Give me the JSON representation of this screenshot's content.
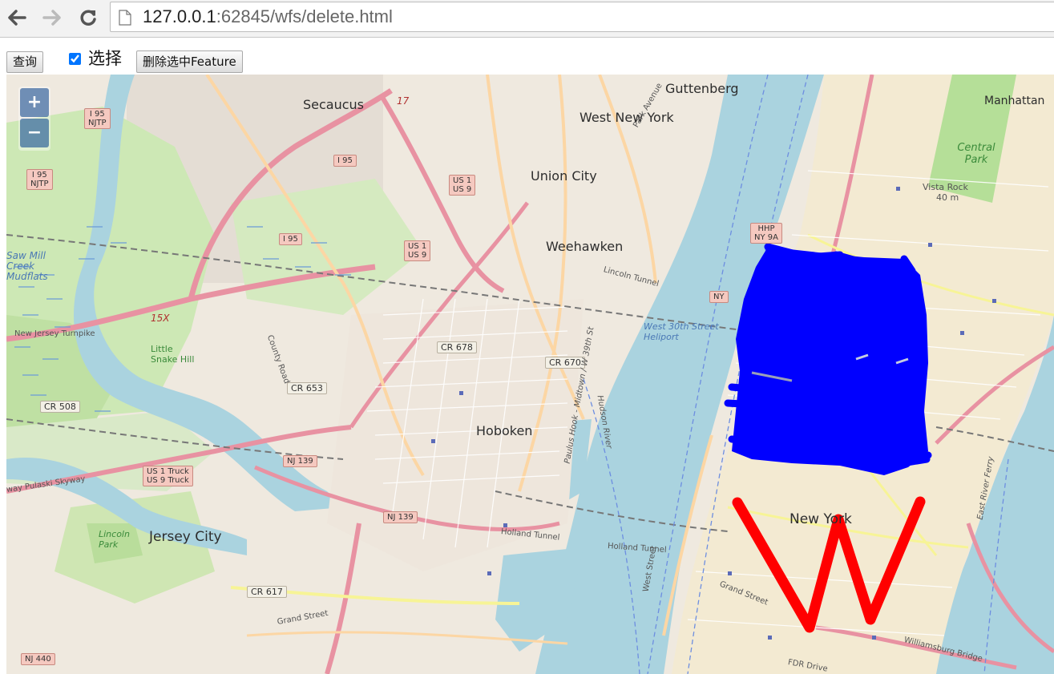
{
  "browser": {
    "url_host": "127.0.0.1",
    "url_rest": ":62845/wfs/delete.html",
    "back_icon": "arrow-left-icon",
    "forward_icon": "arrow-right-icon",
    "reload_icon": "reload-icon",
    "page_icon": "page-icon"
  },
  "toolbar": {
    "query_label": "查询",
    "select_label": "选择",
    "select_checked": true,
    "delete_label": "删除选中Feature"
  },
  "map": {
    "zoom_in": "+",
    "zoom_out": "−",
    "places": {
      "secaucus": "Secaucus",
      "west_new_york": "West New York",
      "guttenberg": "Guttenberg",
      "union_city": "Union City",
      "weehawken": "Weehawken",
      "hoboken": "Hoboken",
      "jersey_city": "Jersey City",
      "new_york": "New York",
      "manhattan": "Manhattan",
      "central_park": "Central Park",
      "vista_rock": "Vista Rock",
      "vista_rock_elev": "40 m",
      "little_snake_hill": "Little Snake Hill",
      "lincoln_park": "Lincoln Park",
      "saw_mill_creek": "Saw Mill Creek Mudflats",
      "west_30th_heliport": "West 30th Street Heliport"
    },
    "shields": {
      "i95_njtp_1": "I 95\nNJTP",
      "i95_njtp_2": "I 95\nNJTP",
      "i95_a": "I 95",
      "i95_b": "I 95",
      "us1_us9_a": "US 1\nUS 9",
      "us1_us9_b": "US 1\nUS 9",
      "us1_truck": "US 1 Truck\nUS 9 Truck",
      "hhp": "HHP\nNY 9A",
      "nj139_a": "NJ 139",
      "nj139_b": "NJ 139",
      "ny": "NY",
      "cr678": "CR 678",
      "cr670": "CR 670",
      "cr653": "CR 653",
      "cr508": "CR 508",
      "cr617": "CR 617",
      "nj440": "NJ 440",
      "exit17": "17",
      "exit15x": "15X"
    },
    "roads": {
      "nj_turnpike": "New Jersey Turnpike",
      "pulaski": "way Pulaski Skyway",
      "lincoln_tunnel": "Lincoln Tunnel",
      "holland_tunnel": "Holland Tunnel",
      "holland_tunnel_2": "Holland Tunnel",
      "grand_street": "Grand Street",
      "grand_street_2": "Grand Street",
      "west_street": "West Street",
      "fdr_drive": "FDR Drive",
      "williamsburg": "Williamsburg Bridge",
      "park_avenue": "Park Avenue",
      "county_road": "County Road",
      "hudson_river": "Hudson River",
      "east_river_ferry": "East River Ferry",
      "paulus_hook": "Paulus Hook - Midtown / W 39th St"
    },
    "colors": {
      "water": "#aad3df",
      "land": "#efe9df",
      "park": "#c8e6a8",
      "motorway": "#e892a2",
      "primary": "#fcd6a4",
      "drawn_polygon": "#0000ff",
      "drawn_line": "#ff0000"
    }
  }
}
